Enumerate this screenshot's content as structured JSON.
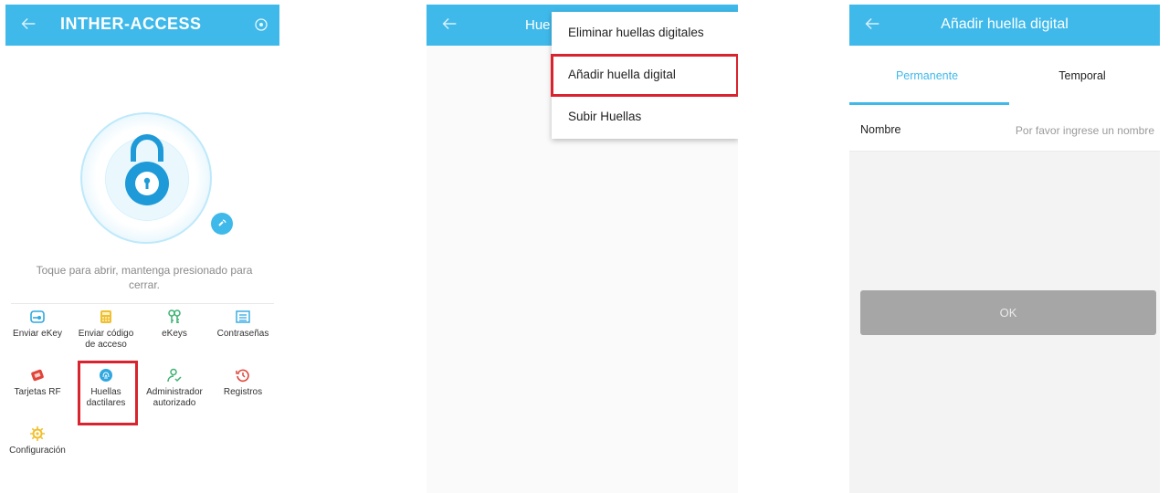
{
  "screen1": {
    "title": "INTHER-ACCESS",
    "hint": "Toque para abrir, mantenga presionado para cerrar.",
    "grid": [
      {
        "name": "send-ekey",
        "label": "Enviar eKey",
        "icon": "send-ekey-icon",
        "color": "#2fa8e0"
      },
      {
        "name": "send-passcode",
        "label": "Enviar código de acceso",
        "icon": "calculator-icon",
        "color": "#f0c030"
      },
      {
        "name": "ekeys",
        "label": "eKeys",
        "icon": "keys-icon",
        "color": "#3cb371"
      },
      {
        "name": "passwords",
        "label": "Contraseñas",
        "icon": "list-icon",
        "color": "#2fa8e0"
      },
      {
        "name": "rf-cards",
        "label": "Tarjetas RF",
        "icon": "rf-card-icon",
        "color": "#e0453a"
      },
      {
        "name": "fingerprints",
        "label": "Huellas dactilares",
        "icon": "fingerprint-icon",
        "color": "#2fa8e0"
      },
      {
        "name": "authorized-admin",
        "label": "Administrador autorizado",
        "icon": "user-check-icon",
        "color": "#3cb371"
      },
      {
        "name": "records",
        "label": "Registros",
        "icon": "history-icon",
        "color": "#e0453a"
      },
      {
        "name": "settings",
        "label": "Configuración",
        "icon": "gear-icon",
        "color": "#f0c030"
      }
    ]
  },
  "screen2": {
    "partial_title": "Hue",
    "menu": [
      {
        "label": "Eliminar huellas digitales"
      },
      {
        "label": "Añadir huella digital"
      },
      {
        "label": "Subir Huellas"
      }
    ]
  },
  "screen3": {
    "title": "Añadir huella digital",
    "tabs": [
      {
        "label": "Permanente"
      },
      {
        "label": "Temporal"
      }
    ],
    "name_label": "Nombre",
    "name_placeholder": "Por favor ingrese un nombre",
    "name_value": "",
    "ok_label": "OK"
  },
  "colors": {
    "accent": "#3fb9ea",
    "highlight": "#d9232e",
    "button_disabled": "#a6a6a6"
  }
}
